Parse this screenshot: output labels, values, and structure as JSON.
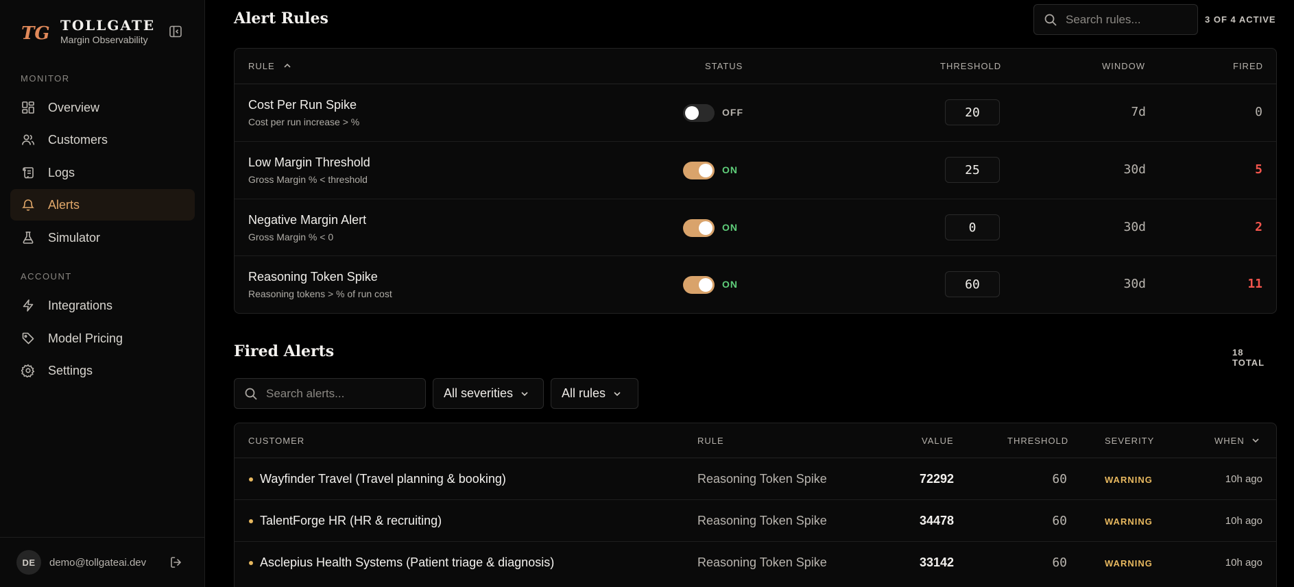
{
  "brand": {
    "name": "TOLLGATE",
    "subtitle": "Margin Observability",
    "logo_text": "TG",
    "accent": "#e1895a"
  },
  "sidebar": {
    "monitor_heading": "MONITOR",
    "monitor_items": [
      {
        "label": "Overview",
        "icon": "grid-icon"
      },
      {
        "label": "Customers",
        "icon": "users-icon"
      },
      {
        "label": "Logs",
        "icon": "scroll-icon"
      },
      {
        "label": "Alerts",
        "icon": "bell-icon",
        "active": true
      },
      {
        "label": "Simulator",
        "icon": "flask-icon"
      }
    ],
    "account_heading": "ACCOUNT",
    "account_items": [
      {
        "label": "Integrations",
        "icon": "bolt-icon"
      },
      {
        "label": "Model Pricing",
        "icon": "tag-icon"
      },
      {
        "label": "Settings",
        "icon": "gear-icon"
      }
    ],
    "user": {
      "initials": "DE",
      "email": "demo@tollgateai.dev"
    }
  },
  "alert_rules": {
    "title": "Alert Rules",
    "search_placeholder": "Search rules...",
    "active_count": "3 OF 4 ACTIVE",
    "columns": {
      "rule": "RULE",
      "status": "STATUS",
      "threshold": "THRESHOLD",
      "window": "WINDOW",
      "fired": "FIRED"
    },
    "rows": [
      {
        "name": "Cost Per Run Spike",
        "desc": "Cost per run increase > %",
        "enabled": false,
        "status": "OFF",
        "threshold": "20",
        "window": "7d",
        "fired": "0"
      },
      {
        "name": "Low Margin Threshold",
        "desc": "Gross Margin % < threshold",
        "enabled": true,
        "status": "ON",
        "threshold": "25",
        "window": "30d",
        "fired": "5"
      },
      {
        "name": "Negative Margin Alert",
        "desc": "Gross Margin % < 0",
        "enabled": true,
        "status": "ON",
        "threshold": "0",
        "window": "30d",
        "fired": "2"
      },
      {
        "name": "Reasoning Token Spike",
        "desc": "Reasoning tokens > % of run cost",
        "enabled": true,
        "status": "ON",
        "threshold": "60",
        "window": "30d",
        "fired": "11"
      }
    ]
  },
  "fired_alerts": {
    "title": "Fired Alerts",
    "total": "18 TOTAL",
    "search_placeholder": "Search alerts...",
    "severity_filter": "All severities",
    "rule_filter": "All rules",
    "columns": {
      "customer": "CUSTOMER",
      "rule": "RULE",
      "value": "VALUE",
      "threshold": "THRESHOLD",
      "severity": "SEVERITY",
      "when": "WHEN"
    },
    "rows": [
      {
        "customer": "Wayfinder Travel (Travel planning & booking)",
        "rule": "Reasoning Token Spike",
        "value": "72292",
        "threshold": "60",
        "severity": "WARNING",
        "when": "10h ago"
      },
      {
        "customer": "TalentForge HR (HR & recruiting)",
        "rule": "Reasoning Token Spike",
        "value": "34478",
        "threshold": "60",
        "severity": "WARNING",
        "when": "10h ago"
      },
      {
        "customer": "Asclepius Health Systems (Patient triage & diagnosis)",
        "rule": "Reasoning Token Spike",
        "value": "33142",
        "threshold": "60",
        "severity": "WARNING",
        "when": "10h ago"
      }
    ]
  },
  "colors": {
    "on": "#5fce7a",
    "off": "#b7b3ad",
    "fired_nonzero": "#f2554d",
    "fired_zero": "#b7b3ad",
    "warning": "#e7b85f",
    "active_nav": "#e1a86a"
  }
}
